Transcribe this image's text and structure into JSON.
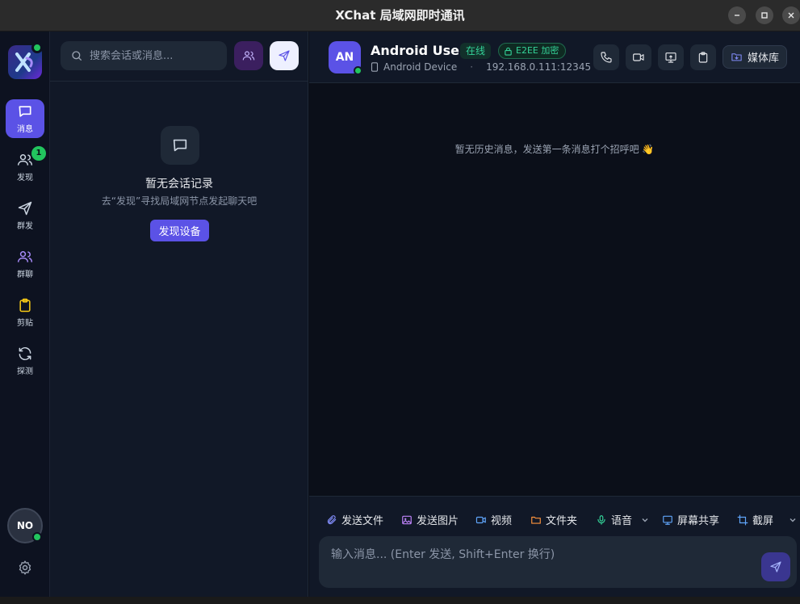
{
  "window": {
    "title": "XChat 局域网即时通讯"
  },
  "nav": {
    "items": [
      {
        "label": "消息",
        "icon": "chat-icon",
        "active": true
      },
      {
        "label": "发现",
        "icon": "users-icon",
        "badge": "1"
      },
      {
        "label": "群发",
        "icon": "send-icon"
      },
      {
        "label": "群聊",
        "icon": "group-icon"
      },
      {
        "label": "剪贴",
        "icon": "clipboard-icon"
      },
      {
        "label": "探测",
        "icon": "refresh-icon"
      }
    ],
    "me_initials": "NO"
  },
  "sidebar": {
    "search_placeholder": "搜索会话或消息...",
    "empty_title": "暂无会话记录",
    "empty_subtitle": "去“发现”寻找局域网节点发起聊天吧",
    "discover_button": "发现设备"
  },
  "chat": {
    "peer_initials": "AN",
    "peer_name": "Android User",
    "status": "在线",
    "encryption": "E2EE 加密",
    "device": "Android Device",
    "separator": "·",
    "address": "192.168.0.111:12345",
    "media_library": "媒体库",
    "empty_hint": "暂无历史消息，发送第一条消息打个招呼吧 👋",
    "toolbar": {
      "send_file": "发送文件",
      "send_image": "发送图片",
      "video": "视频",
      "folder": "文件夹",
      "voice": "语音",
      "screen_share": "屏幕共享",
      "screenshot": "截屏"
    },
    "input_placeholder": "输入消息... (Enter 发送, Shift+Enter 换行)"
  },
  "colors": {
    "accent": "#5b52e6",
    "online": "#22c55e",
    "background": "#0b0f19",
    "panel": "#111827"
  }
}
